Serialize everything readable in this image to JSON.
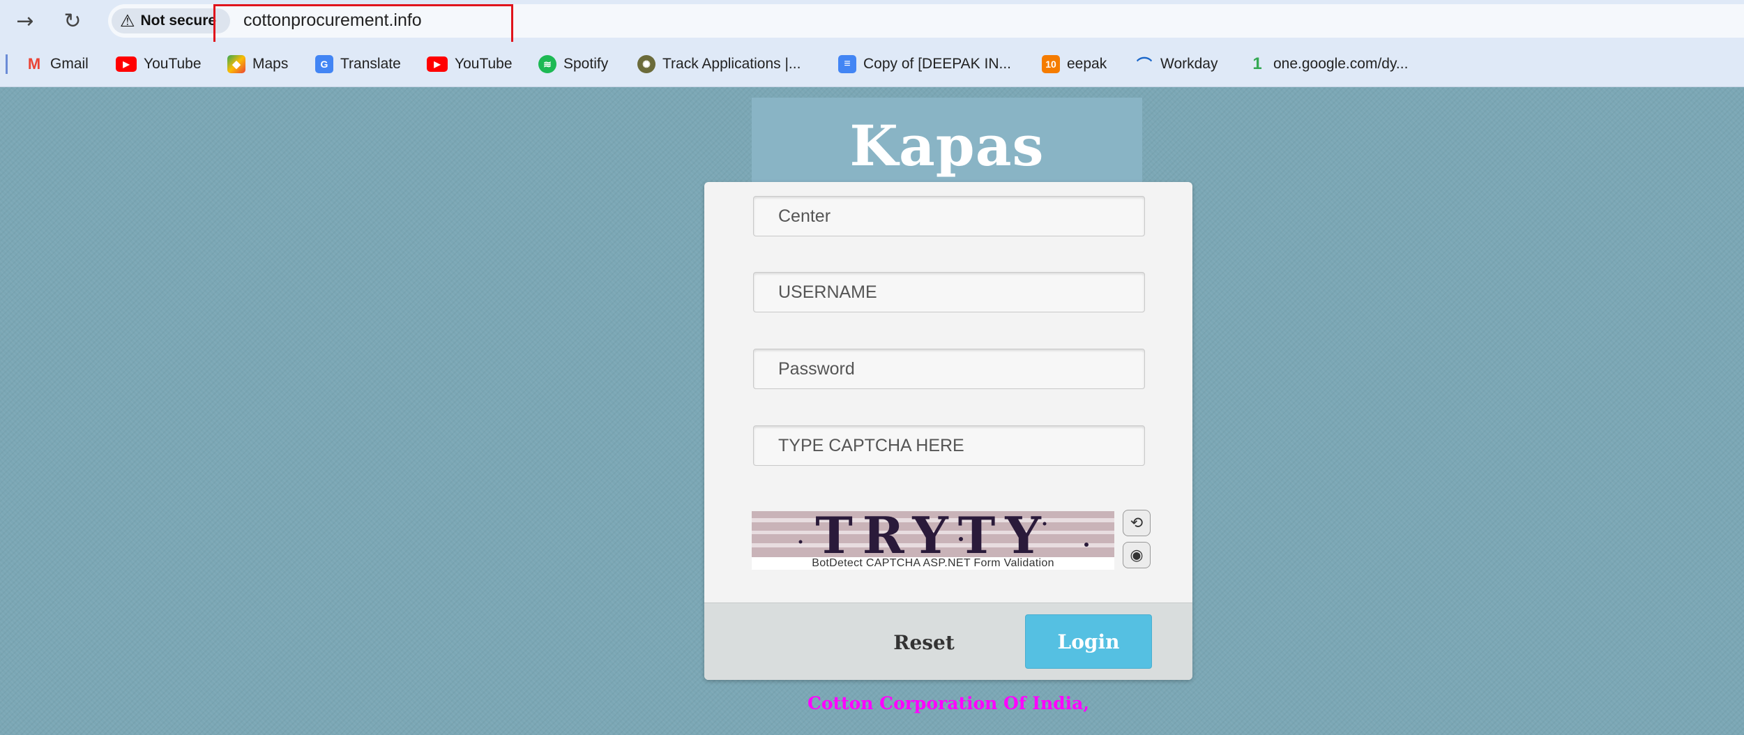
{
  "browser": {
    "security_label": "Not secure",
    "url": "cottonprocurement.info",
    "bookmarks": [
      {
        "label": "Gmail",
        "icon": "gmail-icon",
        "color": "#ea4335"
      },
      {
        "label": "YouTube",
        "icon": "youtube-icon",
        "color": "#ff0000"
      },
      {
        "label": "Maps",
        "icon": "maps-icon",
        "color": "#34a853"
      },
      {
        "label": "Translate",
        "icon": "translate-icon",
        "color": "#4285f4"
      },
      {
        "label": "YouTube",
        "icon": "youtube-icon",
        "color": "#ff0000"
      },
      {
        "label": "Spotify",
        "icon": "spotify-icon",
        "color": "#1db954"
      },
      {
        "label": "Track Applications |...",
        "icon": "emblem-icon",
        "color": "#6b6b3a"
      },
      {
        "label": "Copy of [DEEPAK IN...",
        "icon": "docs-icon",
        "color": "#4285f4"
      },
      {
        "label": "eepak",
        "icon": "number-badge-icon",
        "badge": "10",
        "color": "#f57c00"
      },
      {
        "label": "Workday",
        "icon": "workday-icon",
        "color": "#f5a623"
      },
      {
        "label": "one.google.com/dy...",
        "icon": "google-one-icon",
        "color": "#34a853"
      }
    ]
  },
  "page": {
    "brand_title": "Kapas Kisan",
    "form": {
      "center_placeholder": "Center",
      "username_placeholder": "USERNAME",
      "password_placeholder": "Password",
      "captcha_placeholder": "TYPE CAPTCHA HERE",
      "captcha_text": "TRYTY",
      "captcha_caption": "BotDetect CAPTCHA ASP.NET Form Validation",
      "reset_label": "Reset",
      "login_label": "Login"
    },
    "footer": {
      "org_name": "Cotton Corporation Of India,",
      "org_sub": ""
    },
    "colors": {
      "background": "#7ba7b5",
      "login_button": "#55c0e2",
      "org_name": "#ff00ff",
      "url_highlight": "#e0141c"
    }
  }
}
